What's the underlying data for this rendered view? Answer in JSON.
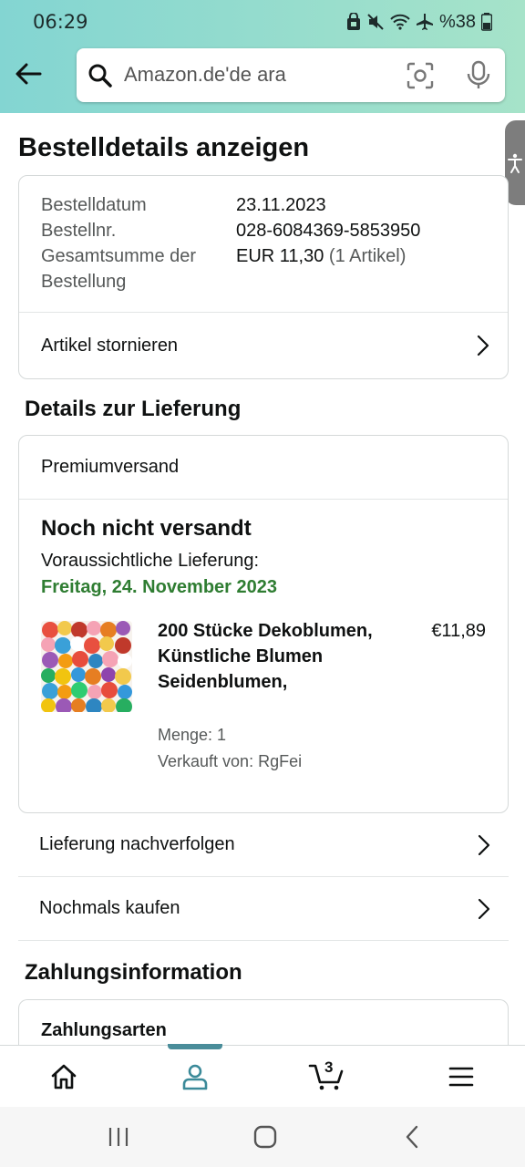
{
  "status_bar": {
    "time": "06:29",
    "battery": "%38",
    "icons": [
      "lock-icon",
      "mute-icon",
      "wifi-icon",
      "airplane-icon",
      "battery-icon"
    ]
  },
  "search": {
    "placeholder": "Amazon.de'de ara"
  },
  "page": {
    "title": "Bestelldetails anzeigen"
  },
  "order_summary": {
    "date_label": "Bestelldatum",
    "date_value": "23.11.2023",
    "number_label": "Bestellnr.",
    "number_value": "028-6084369-5853950",
    "total_label": "Gesamtsumme der Bestellung",
    "total_value": "EUR 11,30",
    "total_items": "(1 Artikel)",
    "cancel_label": "Artikel stornieren"
  },
  "delivery": {
    "section_title": "Details zur Lieferung",
    "shipping_method": "Premiumversand",
    "status": "Noch nicht versandt",
    "estimated_label": "Voraussichtliche Lieferung:",
    "estimated_date": "Freitag, 24. November 2023",
    "product": {
      "title": "200 Stücke Dekoblumen, Künstliche Blumen Seidenblumen,",
      "price": "€11,89",
      "quantity": "Menge: 1",
      "seller": "Verkauft von: RgFei"
    },
    "track_label": "Lieferung nachverfolgen",
    "buy_again_label": "Nochmals kaufen"
  },
  "payment": {
    "section_title": "Zahlungsinformation",
    "methods_label": "Zahlungsarten"
  },
  "bottom_nav": {
    "cart_count": "3",
    "items": [
      "home-icon",
      "account-icon",
      "cart-icon",
      "menu-icon"
    ]
  },
  "colors": {
    "header_gradient_start": "#83d5d2",
    "header_gradient_end": "#a6e3c9",
    "delivery_date_green": "#2f7d32",
    "active_tab_indicator": "#4a8d9a"
  }
}
